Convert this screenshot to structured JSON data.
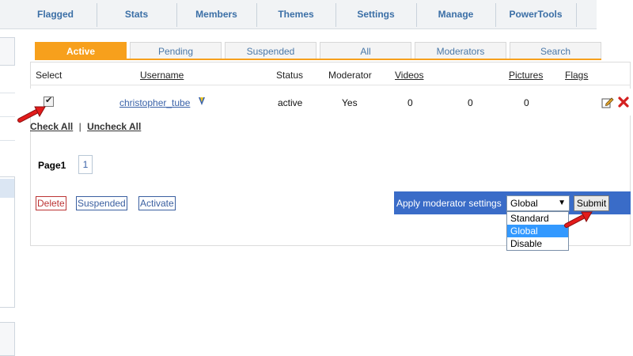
{
  "nav": {
    "items": [
      "Flagged",
      "Stats",
      "Members",
      "Themes",
      "Settings",
      "Manage",
      "PowerTools"
    ]
  },
  "tabs": [
    "Active",
    "Pending",
    "Suspended",
    "All",
    "Moderators",
    "Search"
  ],
  "table": {
    "headers": {
      "select": "Select",
      "username": "Username",
      "status": "Status",
      "moderator": "Moderator",
      "videos": "Videos",
      "pictures": "Pictures",
      "flags": "Flags"
    },
    "row": {
      "username": "christopher_tube",
      "status": "active",
      "moderator": "Yes",
      "videos": "0",
      "col5": "0",
      "pictures": "0"
    }
  },
  "check_all": "Check All",
  "check_sep": "|",
  "uncheck_all": "Uncheck All",
  "pager": {
    "label": "Page1",
    "current": "1"
  },
  "actions": {
    "delete": "Delete",
    "suspended": "Suspended",
    "activate": "Activate"
  },
  "moderator_settings": {
    "label": "Apply moderator settings",
    "selected": "Global",
    "options": [
      "Standard",
      "Global",
      "Disable"
    ],
    "submit": "Submit"
  },
  "colors": {
    "accent_tab": "#f7a01c",
    "modbar": "#3a6cc8",
    "highlight": "#3399ff"
  }
}
